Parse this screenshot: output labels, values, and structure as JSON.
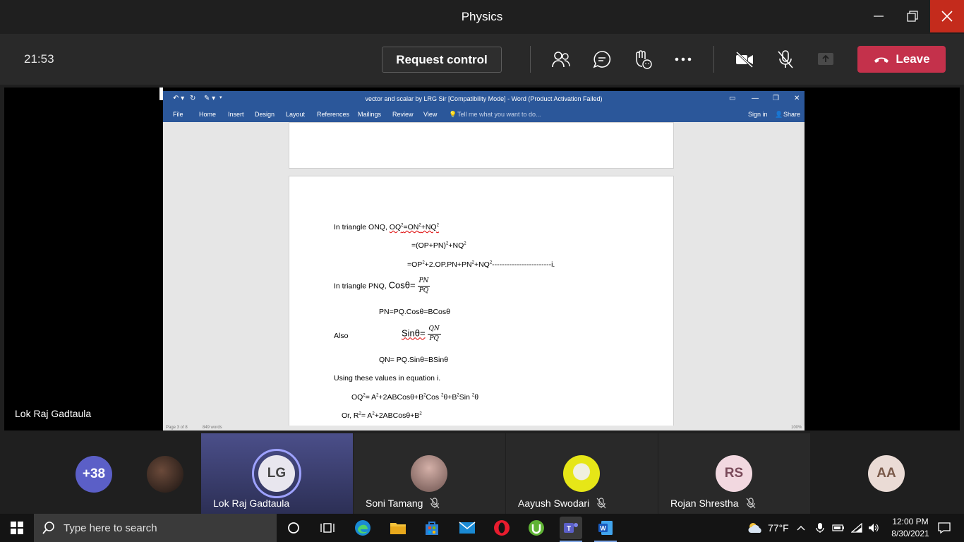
{
  "window": {
    "title": "Physics"
  },
  "call": {
    "timer": "21:53",
    "request_control": "Request control",
    "leave_label": "Leave",
    "presenter_name": "Lok Raj Gadtaula"
  },
  "word": {
    "title": "vector and scalar by LRG Sir [Compatibility Mode] - Word (Product Activation Failed)",
    "tabs": [
      "File",
      "Home",
      "Insert",
      "Design",
      "Layout",
      "References",
      "Mailings",
      "Review",
      "View"
    ],
    "tell_me": "Tell me what you want to do...",
    "sign_in": "Sign in",
    "share": "Share",
    "status_page": "Page 3 of 8",
    "status_words": "849 words",
    "status_zoom": "100%",
    "doc": {
      "l1_prefix": "In triangle ONQ,",
      "l1_eq": "OQ²=ON²+NQ²",
      "l2": "=(OP+PN)²+NQ²",
      "l3": "=OP²+2.OP.PN+PN²+NQ²------------------------i.",
      "l4_prefix": "In triangle PNQ,",
      "l4_func": "Cosθ=",
      "l4_num": "PN",
      "l4_den": "PQ",
      "l5": "PN=PQ.Cosθ=BCosθ",
      "l6_prefix": "Also",
      "l6_func": "Sinθ=",
      "l6_num": "QN",
      "l6_den": "PQ",
      "l7": "QN= PQ.Sinθ=BSinθ",
      "l8": "Using these values in equation i.",
      "l9": "OQ²= A²+2ABCosθ+B²Cos ²θ+B²Sin ²θ",
      "l10": "Or, R²= A²+2ABCosθ+B²"
    }
  },
  "participants": [
    {
      "initials": "+38",
      "name": "",
      "color": "#5b5fc7"
    },
    {
      "initials": "",
      "name": "",
      "color": "#3a2a20"
    },
    {
      "initials": "LG",
      "name": "Lok Raj Gadtaula",
      "color": "#e8e6ee"
    },
    {
      "initials": "",
      "name": "Soni Tamang",
      "color": "#8a6d6a"
    },
    {
      "initials": "",
      "name": "Aayush Swodari",
      "color": "#e6e617"
    },
    {
      "initials": "RS",
      "name": "Rojan Shrestha",
      "color": "#f2d8e0"
    },
    {
      "initials": "AA",
      "name": "",
      "color": "#eadbd5"
    }
  ],
  "taskbar": {
    "search_placeholder": "Type here to search",
    "weather": "77°F",
    "time": "12:00 PM",
    "date": "8/30/2021"
  }
}
